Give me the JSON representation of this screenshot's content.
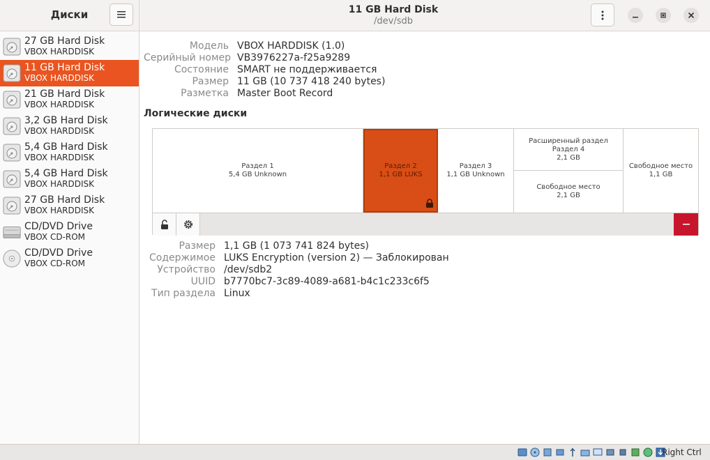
{
  "sidebar": {
    "title": "Диски",
    "drives": [
      {
        "name": "27 GB Hard Disk",
        "model": "VBOX HARDDISK",
        "icon": "hard-disk-icon"
      },
      {
        "name": "11 GB Hard Disk",
        "model": "VBOX HARDDISK",
        "icon": "hard-disk-icon",
        "selected": true
      },
      {
        "name": "21 GB Hard Disk",
        "model": "VBOX HARDDISK",
        "icon": "hard-disk-icon"
      },
      {
        "name": "3,2 GB Hard Disk",
        "model": "VBOX HARDDISK",
        "icon": "hard-disk-icon"
      },
      {
        "name": "5,4 GB Hard Disk",
        "model": "VBOX HARDDISK",
        "icon": "hard-disk-icon"
      },
      {
        "name": "5,4 GB Hard Disk",
        "model": "VBOX HARDDISK",
        "icon": "hard-disk-icon"
      },
      {
        "name": "27 GB Hard Disk",
        "model": "VBOX HARDDISK",
        "icon": "hard-disk-icon"
      },
      {
        "name": "CD/DVD Drive",
        "model": "VBOX CD-ROM",
        "icon": "optical-drive-icon"
      },
      {
        "name": "CD/DVD Drive",
        "model": "VBOX CD-ROM",
        "icon": "optical-disc-icon"
      }
    ]
  },
  "header": {
    "title": "11 GB Hard Disk",
    "subtitle": "/dev/sdb"
  },
  "disk_info": {
    "model_label": "Модель",
    "model": "VBOX HARDDISK (1.0)",
    "serial_label": "Серийный номер",
    "serial": "VB3976227a-f25a9289",
    "state_label": "Состояние",
    "state": "SMART не поддерживается",
    "size_label": "Размер",
    "size": "11 GB (10 737 418 240 bytes)",
    "partitioning_label": "Разметка",
    "partitioning": "Master Boot Record"
  },
  "volumes": {
    "title": "Логические диски",
    "partitions": [
      {
        "name": "Раздел 1",
        "detail": "5,4 GB Unknown"
      },
      {
        "name": "Раздел 2",
        "detail": "1,1 GB LUKS",
        "selected": true
      },
      {
        "name": "Раздел 3",
        "detail": "1,1 GB Unknown"
      },
      {
        "name": "Расширенный раздел",
        "name2": "Раздел 4",
        "detail": "2,1 GB"
      },
      {
        "name": "Свободное место",
        "detail": "2,1 GB"
      },
      {
        "name": "Свободное место",
        "detail": "1,1 GB"
      }
    ]
  },
  "partition_info": {
    "size_label": "Размер",
    "size": "1,1 GB (1 073 741 824 bytes)",
    "content_label": "Содержимое",
    "content": "LUKS Encryption (version 2) — Заблокирован",
    "device_label": "Устройство",
    "device": "/dev/sdb2",
    "uuid_label": "UUID",
    "uuid": "b7770bc7-3c89-4089-a681-b4c1c233c6f5",
    "type_label": "Тип раздела",
    "type": "Linux"
  },
  "statusbar": {
    "host_key": "Right Ctrl"
  },
  "colors": {
    "accent": "#e95420",
    "selected_partition": "#d84e16",
    "delete_button": "#c7162b"
  }
}
